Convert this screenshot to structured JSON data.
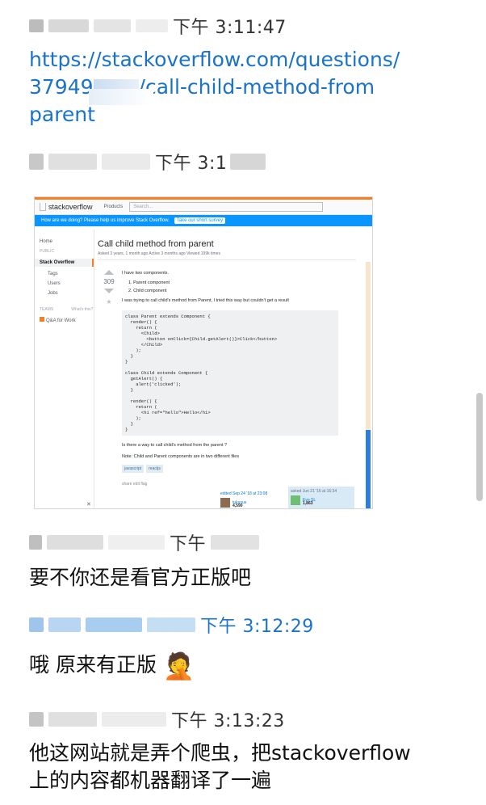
{
  "messages": [
    {
      "time": "下午 3:11:47",
      "link": [
        "https://stackoverflow.com/questions/",
        "37949",
        "/call-child-method-from",
        "parent"
      ]
    },
    {
      "time": "下午 3:1"
    },
    {
      "time": "下午"
    },
    {
      "text": "要不你还是看官方正版吧"
    },
    {
      "time": "下午 3:12:29"
    },
    {
      "text": "哦 原来有正版",
      "emoji": "🤦"
    },
    {
      "time": "下午 3:13:23"
    },
    {
      "text_lines": [
        "他这网站就是弄个爬虫，把stackoverflow",
        "上的内容都机器翻译了一遍"
      ]
    }
  ],
  "screenshot": {
    "logo": "stackoverflow",
    "nav": "Products",
    "search_placeholder": "Search...",
    "banner": "How are we doing? Please help us improve Stack Overflow.",
    "banner_button": "Take our short survey",
    "sidebar": [
      "Home",
      "PUBLIC",
      "Stack Overflow",
      "Tags",
      "Users",
      "Jobs",
      "TEAMS",
      "What's this?",
      "Q&A for Work"
    ],
    "title": "Call child method from parent",
    "meta": "Asked 3 years, 1 month ago   Active 3 months ago   Viewed 199k times",
    "votes": "309",
    "p1": "I have two components.",
    "list": [
      "1. Parent component",
      "2. Child component"
    ],
    "p2": "I was trying to call child's method from Parent, I tried this way but couldn't get a result",
    "code": "class Parent extends Component {\n  render() {\n    return (\n      <Child>\n        <button onClick={Child.getAlert()}>Click</button>\n      </Child>\n    );\n  }\n}\n\nclass Child extends Component {\n  getAlert() {\n    alert('clicked');\n  }\n\n  render() {\n    return (\n      <h1 ref=\"hello\">Hello</h1>\n    );\n  }\n}",
    "p3": "Is there a way to call child's method from the parent ?",
    "p4": "Note: Child and Parent components are in two different files",
    "tags": [
      "javascript",
      "reactjs"
    ],
    "actions": "share  edit  flag",
    "edited": "edited Sep 24 '18 at 23:08",
    "editor": "tukusus",
    "editor_rep": "4,590",
    "asked": "asked Jun 21 '16 at 16:34",
    "asker": "Evo SL",
    "asker_rep": "1,863"
  },
  "colors": {
    "link": "#1a73c9",
    "so_orange": "#f48024",
    "so_blue": "#0a95ff"
  }
}
